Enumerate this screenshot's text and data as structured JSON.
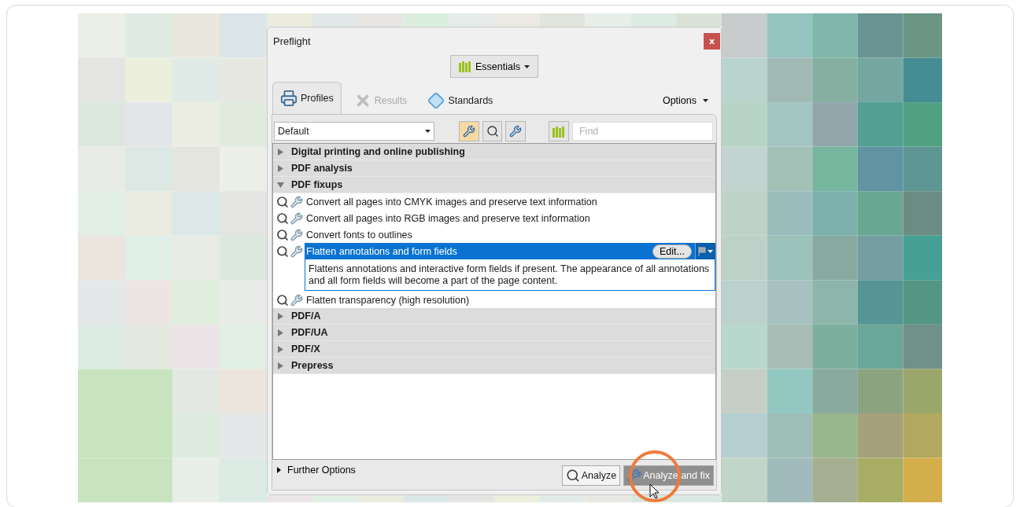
{
  "window": {
    "title": "Preflight",
    "close_label": "x"
  },
  "workspace_button": {
    "label": "Essentials"
  },
  "tabs": [
    {
      "label": "Profiles",
      "selected": true,
      "disabled": false,
      "kind": "printer"
    },
    {
      "label": "Results",
      "selected": false,
      "disabled": true,
      "kind": "results"
    },
    {
      "label": "Standards",
      "selected": false,
      "disabled": false,
      "kind": "diamond"
    }
  ],
  "options_menu": {
    "label": "Options"
  },
  "profile_select": {
    "value": "Default"
  },
  "find_field": {
    "placeholder": "Find"
  },
  "tree": [
    {
      "label": "Digital printing and online publishing",
      "expanded": false
    },
    {
      "label": "PDF analysis",
      "expanded": false
    },
    {
      "label": "PDF fixups",
      "expanded": true,
      "children": [
        {
          "label": "Convert all pages into CMYK images and preserve text information",
          "selected": false
        },
        {
          "label": "Convert all pages into RGB images and preserve text information",
          "selected": false
        },
        {
          "label": "Convert fonts to outlines",
          "selected": false
        },
        {
          "label": "Flatten annotations and form fields",
          "selected": true,
          "edit_label": "Edit...",
          "description": "Flattens annotations and interactive form fields if present. The appearance of all annotations and all form fields will become a part of the page content."
        },
        {
          "label": "Flatten transparency (high resolution)",
          "selected": false
        }
      ]
    },
    {
      "label": "PDF/A",
      "expanded": false
    },
    {
      "label": "PDF/UA",
      "expanded": false
    },
    {
      "label": "PDF/X",
      "expanded": false
    },
    {
      "label": "Prepress",
      "expanded": false
    }
  ],
  "further_options": {
    "label": "Further Options",
    "expanded": false
  },
  "buttons": [
    {
      "label": "Analyze",
      "kind": "analyze",
      "disabled": false
    },
    {
      "label": "Analyze and fix",
      "kind": "fix",
      "disabled": true
    }
  ]
}
